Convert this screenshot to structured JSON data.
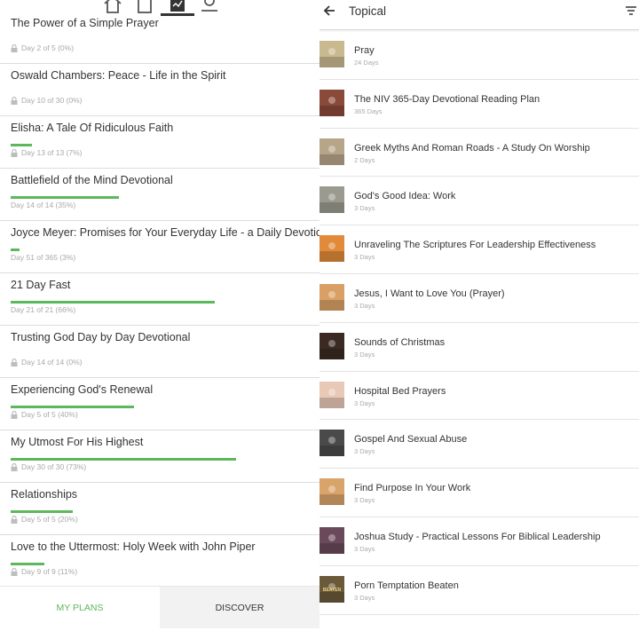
{
  "left_panel": {
    "top_icons": [
      "home-icon",
      "bookmark-icon",
      "plans-icon",
      "profile-icon"
    ],
    "plans": [
      {
        "title": "The Power of a Simple Prayer",
        "meta": "Day 2 of 5 (0%)",
        "locked": true,
        "progress": 0
      },
      {
        "title": "Oswald Chambers: Peace - Life in the Spirit",
        "meta": "Day 10 of 30 (0%)",
        "locked": true,
        "progress": 0
      },
      {
        "title": "Elisha: A Tale Of Ridiculous Faith",
        "meta": "Day 13 of 13 (7%)",
        "locked": true,
        "progress": 0.07
      },
      {
        "title": "Battlefield of the Mind Devotional",
        "meta": "Day 14 of 14 (35%)",
        "locked": false,
        "progress": 0.35
      },
      {
        "title": "Joyce Meyer: Promises for Your Everyday Life - a Daily Devotional",
        "meta": "Day 51 of 365 (3%)",
        "locked": false,
        "progress": 0.03
      },
      {
        "title": "21 Day Fast",
        "meta": "Day 21 of 21 (66%)",
        "locked": false,
        "progress": 0.66
      },
      {
        "title": "Trusting God Day by Day Devotional",
        "meta": "Day 14 of 14 (0%)",
        "locked": true,
        "progress": 0
      },
      {
        "title": "Experiencing God's Renewal",
        "meta": "Day 5 of 5 (40%)",
        "locked": true,
        "progress": 0.4
      },
      {
        "title": "My Utmost For His Highest",
        "meta": "Day 30 of 30 (73%)",
        "locked": true,
        "progress": 0.73
      },
      {
        "title": "Relationships",
        "meta": "Day 5 of 5 (20%)",
        "locked": true,
        "progress": 0.2
      },
      {
        "title": "Love to the Uttermost: Holy Week with John Piper",
        "meta": "Day 9 of 9 (11%)",
        "locked": true,
        "progress": 0.11
      }
    ],
    "tabs": {
      "my_plans": "MY PLANS",
      "discover": "DISCOVER"
    },
    "colors": {
      "accent": "#5cb85c",
      "inactive_tab_bg": "#f2f2f2"
    }
  },
  "right_panel": {
    "title": "Topical",
    "back_icon": "arrow-left-icon",
    "filter_icon": "filter-icon",
    "topics": [
      {
        "title": "Pray",
        "days": "24 Days",
        "thumb": "#c9b98f"
      },
      {
        "title": "The NIV 365-Day Devotional Reading Plan",
        "days": "365 Days",
        "thumb": "#8a4a3a"
      },
      {
        "title": "Greek Myths And Roman Roads - A Study On Worship",
        "days": "2 Days",
        "thumb": "#b7a58a"
      },
      {
        "title": "God's Good Idea: Work",
        "days": "3 Days",
        "thumb": "#9a9a8e"
      },
      {
        "title": "Unraveling The Scriptures For Leadership Effectiveness",
        "days": "3 Days",
        "thumb": "#e08a3a"
      },
      {
        "title": "Jesus, I Want to Love You (Prayer)",
        "days": "3 Days",
        "thumb": "#d9a066"
      },
      {
        "title": "Sounds of Christmas",
        "days": "3 Days",
        "thumb": "#3a2a22"
      },
      {
        "title": "Hospital Bed Prayers",
        "days": "3 Days",
        "thumb": "#e8c9b5"
      },
      {
        "title": "Gospel And Sexual Abuse",
        "days": "3 Days",
        "thumb": "#4a4a4a"
      },
      {
        "title": "Find Purpose In Your Work",
        "days": "3 Days",
        "thumb": "#d9a46a"
      },
      {
        "title": "Joshua Study - Practical Lessons For Biblical Leadership",
        "days": "3 Days",
        "thumb": "#6a4a5a"
      },
      {
        "title": "Porn Temptation Beaten",
        "days": "3 Days",
        "thumb": "#6a5a3a",
        "thumb_text": "BEATEN"
      }
    ]
  }
}
